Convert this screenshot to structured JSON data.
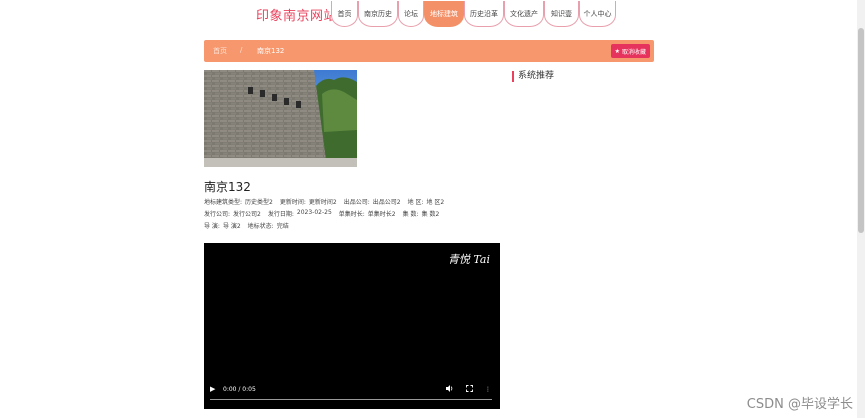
{
  "header": {
    "site_title": "印象南京网站",
    "nav": [
      {
        "label": "首页"
      },
      {
        "label": "南京历史"
      },
      {
        "label": "论坛"
      },
      {
        "label": "地标建筑",
        "active": true
      },
      {
        "label": "历史沿革"
      },
      {
        "label": "文化遗产"
      },
      {
        "label": "知识壹"
      },
      {
        "label": "个人中心"
      }
    ]
  },
  "breadcrumb": {
    "home": "首页",
    "separator": "/",
    "current": "南京132",
    "fav_button": "取消收藏"
  },
  "sidebar": {
    "title": "系统推荐"
  },
  "detail": {
    "title": "南京132",
    "line1": [
      {
        "label": "地标建筑类型:",
        "value": "历史类型2"
      },
      {
        "label": "更新时间:",
        "value": "更新时间2"
      },
      {
        "label": "出品公司:",
        "value": "出品公司2"
      },
      {
        "label": "地 区:",
        "value": "地 区2"
      }
    ],
    "line2": [
      {
        "label": "发行公司:",
        "value": "发行公司2"
      },
      {
        "label": "发行日期:",
        "value": "2023-02-25"
      },
      {
        "label": "单集时长:",
        "value": "单集时长2"
      },
      {
        "label": "集 数:",
        "value": "集 数2"
      }
    ],
    "line3": [
      {
        "label": "导 演:",
        "value": "导 演2"
      },
      {
        "label": "地标状态:",
        "value": "完结"
      }
    ]
  },
  "video": {
    "watermark": "青悦 Tai",
    "time": "0:00 / 0:05"
  },
  "overlay": {
    "watermark": "CSDN @毕设学长"
  },
  "colors": {
    "brand": "#e8425d",
    "crumb_bar": "#f7976d",
    "fav_button": "#e6335d",
    "active_tab": "#f49068"
  }
}
